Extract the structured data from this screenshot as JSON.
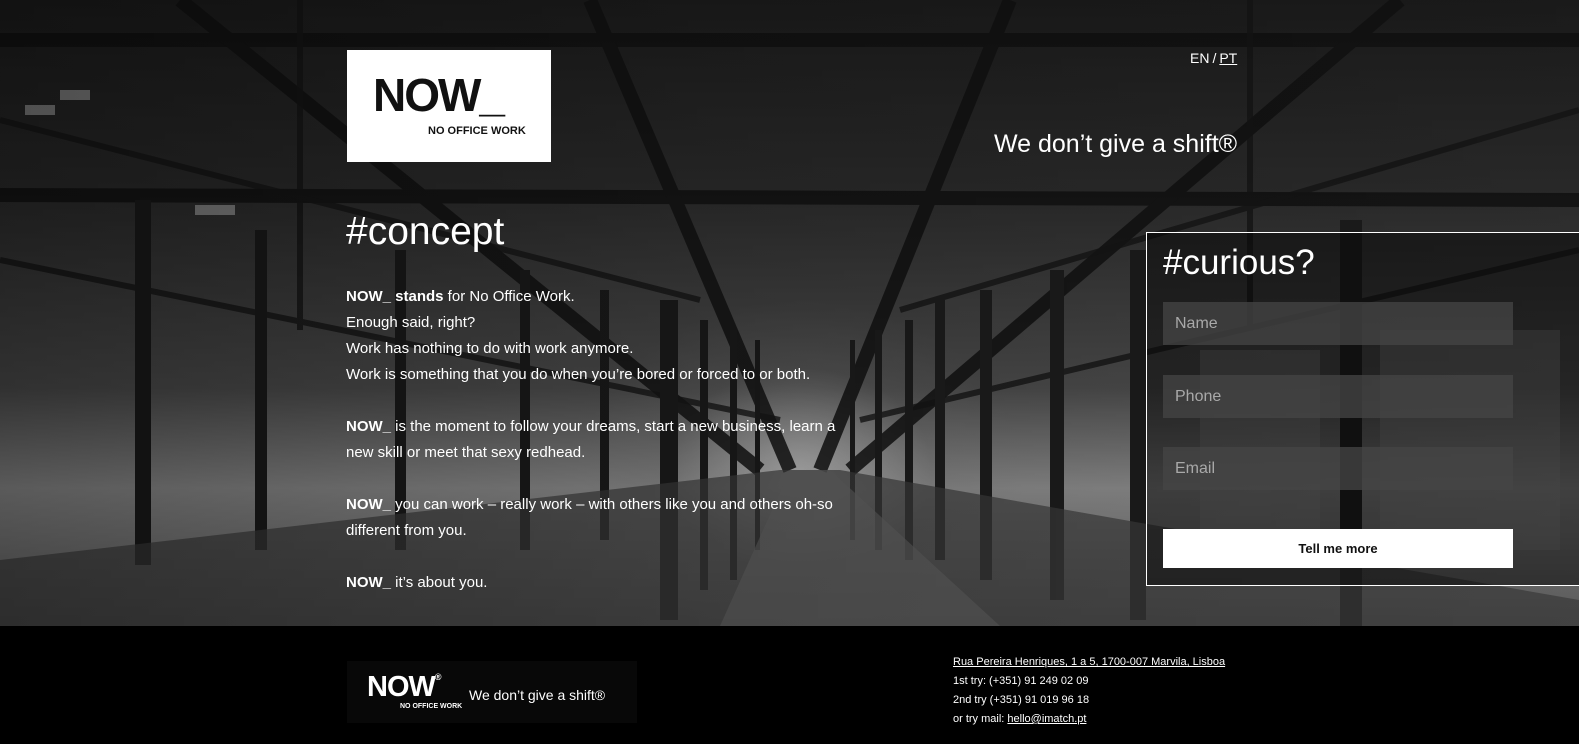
{
  "logo": {
    "mark": "NOW_",
    "sub": "NO OFFICE WORK"
  },
  "lang": {
    "en": "EN",
    "sep": "/",
    "pt": "PT"
  },
  "tagline": "We don’t give a shift®",
  "concept": {
    "title": "#concept",
    "p1_bold": "NOW_ stands",
    "p1_rest": " for No Office Work.",
    "p1_line2": "Enough said, right?",
    "p1_line3": "Work has nothing to do with work anymore.",
    "p1_line4": "Work is something that you do when you’re bored or forced to or both.",
    "p2_bold": "NOW_",
    "p2_rest": " is the moment to follow your dreams, start a new business, learn a new skill or meet that sexy redhead.",
    "p3_bold": "NOW_",
    "p3_rest": " you can work – really work – with others like you and others oh-so different from you.",
    "p4_bold": "NOW_",
    "p4_rest": " it’s about you."
  },
  "form": {
    "title": "#curious?",
    "name_placeholder": "Name",
    "phone_placeholder": "Phone",
    "email_placeholder": "Email",
    "submit_label": "Tell me more"
  },
  "footer": {
    "logo_mark": "NOW",
    "logo_reg": "®",
    "logo_sub": "NO OFFICE WORK",
    "logo_tagline": "We don’t give a shift®",
    "address": "Rua Pereira Henriques, 1 a 5, 1700-007 Marvila, Lisboa",
    "phone1": "1st try: (+351) 91 249 02 09",
    "phone2": "2nd try (+351) 91 019 96 18",
    "mail_prefix": "or try mail: ",
    "mail": "hello@imatch.pt"
  }
}
